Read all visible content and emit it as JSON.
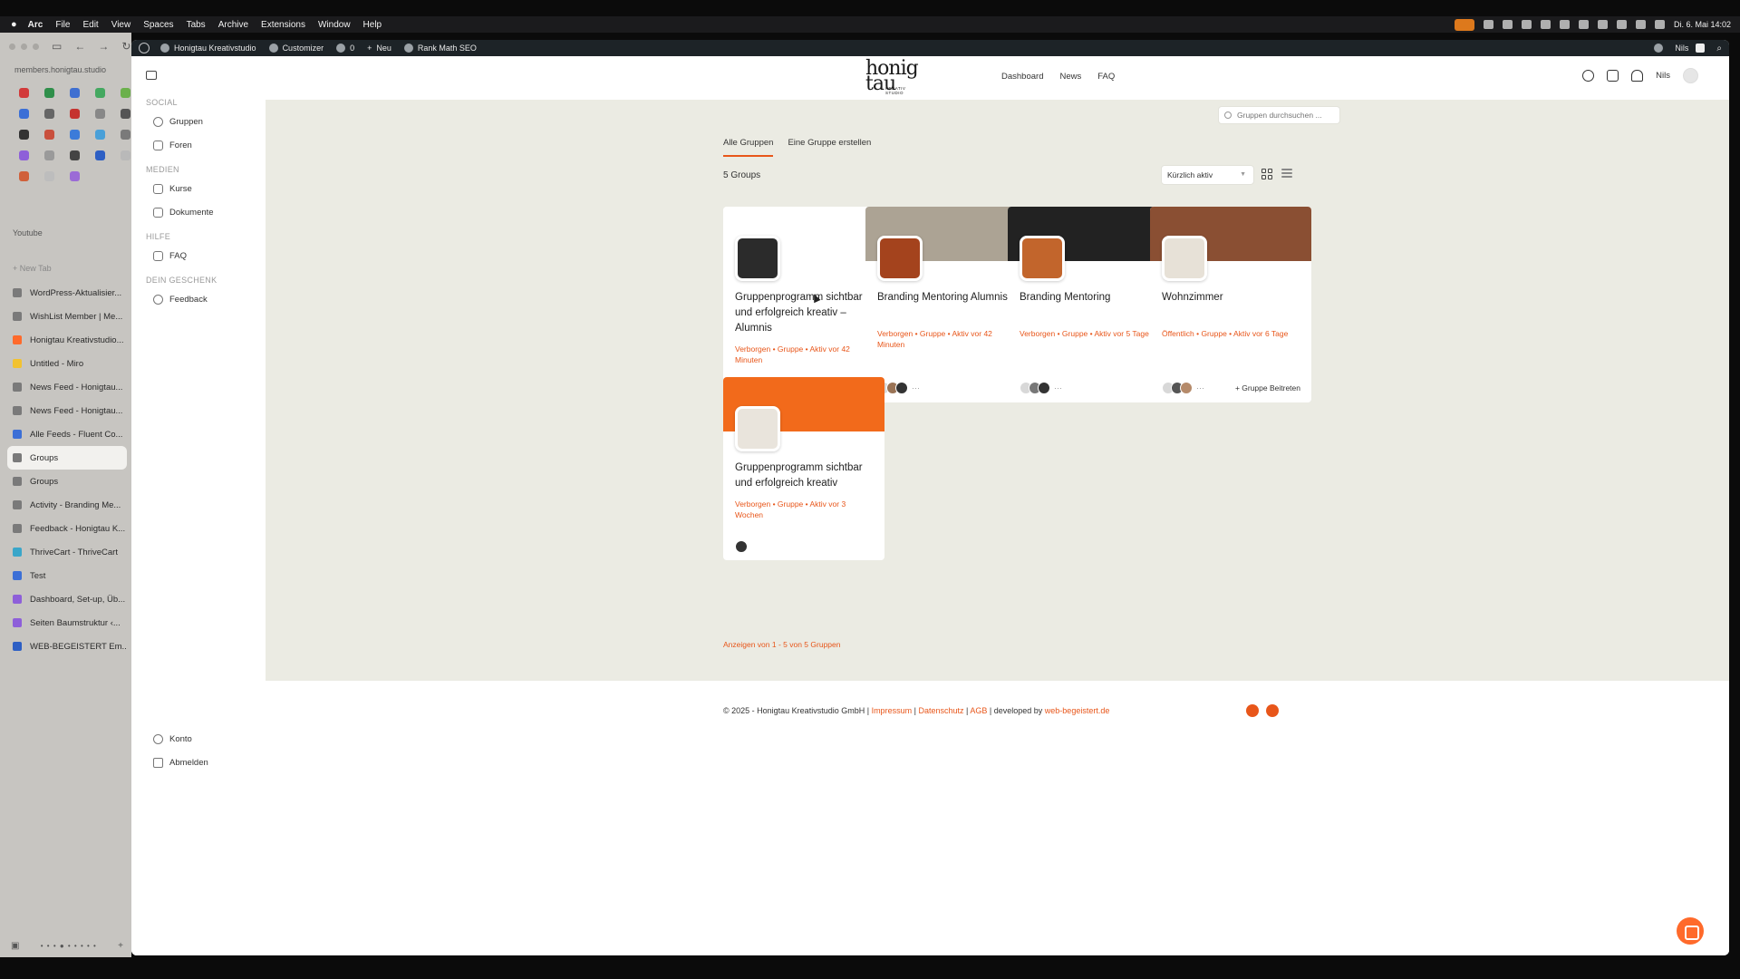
{
  "menubar": {
    "app": "Arc",
    "items": [
      "File",
      "Edit",
      "View",
      "Spaces",
      "Tabs",
      "Archive",
      "Extensions",
      "Window",
      "Help"
    ],
    "clock": "Di. 6. Mai 14:02"
  },
  "arc": {
    "url": "members.honigtau.studio",
    "youtube_label": "Youtube",
    "new_tab": "+  New Tab",
    "favicon_colors": [
      "#d23a3a",
      "#2f8f4a",
      "#3f6fd1",
      "#44a860",
      "#6bb04b",
      "#3b6fd6",
      "#666666",
      "#c5332f",
      "#888888",
      "#555555",
      "#333333",
      "#c9503d",
      "#3c7bd9",
      "#4aa0d8",
      "#7a7a7a",
      "#8e5fd9",
      "#9a9a9a",
      "#444444",
      "#2d5fc4",
      "#b9b9b9",
      "#d0603a",
      "#bdbdbd",
      "#9b6bd6"
    ],
    "tabs": [
      {
        "label": "WordPress-Aktualisier...",
        "color": "#7a7a7a"
      },
      {
        "label": "WishList Member | Me...",
        "color": "#7a7a7a"
      },
      {
        "label": "Honigtau Kreativstudio...",
        "color": "#ff6a2b"
      },
      {
        "label": "Untitled - Miro",
        "color": "#f2c230"
      },
      {
        "label": "News Feed - Honigtau...",
        "color": "#7a7a7a"
      },
      {
        "label": "News Feed - Honigtau...",
        "color": "#7a7a7a"
      },
      {
        "label": "Alle Feeds - Fluent Co...",
        "color": "#3c6fd6"
      },
      {
        "label": "Groups",
        "color": "#7a7a7a"
      },
      {
        "label": "Groups",
        "color": "#7a7a7a"
      },
      {
        "label": "Activity - Branding Me...",
        "color": "#7a7a7a"
      },
      {
        "label": "Feedback - Honigtau K...",
        "color": "#7a7a7a"
      },
      {
        "label": "ThriveCart - ThriveCart",
        "color": "#3aa6c9"
      },
      {
        "label": "Test",
        "color": "#3c6fd6"
      },
      {
        "label": "Dashboard, Set-up, Üb...",
        "color": "#8e5fd9"
      },
      {
        "label": "Seiten Baumstruktur ‹...",
        "color": "#8e5fd9"
      },
      {
        "label": "WEB-BEGEISTERT Em...",
        "color": "#2d5fc4"
      }
    ]
  },
  "wpbar": {
    "site": "Honigtau Kreativstudio",
    "customizer": "Customizer",
    "comments": "0",
    "new": "Neu",
    "seo": "Rank Math SEO",
    "user": "Nils"
  },
  "leftnav": {
    "sections": [
      {
        "title": "SOCIAL",
        "items": [
          "Gruppen",
          "Foren"
        ]
      },
      {
        "title": "MEDIEN",
        "items": [
          "Kurse",
          "Dokumente"
        ]
      },
      {
        "title": "HILFE",
        "items": [
          "FAQ"
        ]
      },
      {
        "title": "DEIN GESCHENK",
        "items": [
          "Feedback"
        ]
      }
    ],
    "konto": "Konto",
    "abmelden": "Abmelden"
  },
  "header": {
    "logo_top": "honig",
    "logo_bottom": "tau",
    "logo_sub": "KREATIV STUDIO",
    "nav": [
      "Dashboard",
      "News",
      "FAQ"
    ],
    "user": "Nils"
  },
  "main": {
    "search_placeholder": "Gruppen durchsuchen ...",
    "tabs": [
      "Alle Gruppen",
      "Eine Gruppe erstellen"
    ],
    "count": "5 Groups",
    "sort": "Kürzlich aktiv",
    "groups": [
      {
        "title": "Gruppenprogramm sichtbar und erfolgreich kreativ – Alumnis",
        "meta": "Verborgen • Gruppe • Aktiv vor 42 Minuten",
        "cover": "#ffffff",
        "thumb": "#2b2b2b",
        "members": [
          "#d8d8d8",
          "#333333"
        ],
        "more": "",
        "join": ""
      },
      {
        "title": "Branding Mentoring Alumnis",
        "meta": "Verborgen • Gruppe • Aktiv vor 42 Minuten",
        "cover": "#aca394",
        "thumb": "#a4431d",
        "members": [
          "#d8d8d8",
          "#9a7355",
          "#333333"
        ],
        "more": "···",
        "join": ""
      },
      {
        "title": "Branding Mentoring",
        "meta": "Verborgen • Gruppe • Aktiv vor 5 Tage",
        "cover": "#222222",
        "thumb": "#c2652c",
        "members": [
          "#d8d8d8",
          "#777777",
          "#333333"
        ],
        "more": "···",
        "join": ""
      },
      {
        "title": "Wohnzimmer",
        "meta": "Öffentlich • Gruppe • Aktiv vor 6 Tage",
        "cover": "#8a4f33",
        "thumb": "#e7e1d7",
        "members": [
          "#d8d8d8",
          "#555555",
          "#b58a6a"
        ],
        "more": "···",
        "join": "+  Gruppe Beitreten"
      },
      {
        "title": "Gruppenprogramm sichtbar und erfolgreich kreativ",
        "meta": "Verborgen • Gruppe • Aktiv vor 3 Wochen",
        "cover": "#f26a1b",
        "thumb": "#e9e4dc",
        "members": [
          "#333333"
        ],
        "more": "",
        "join": ""
      }
    ],
    "pager": "Anzeigen von 1 - 5 von 5 Gruppen"
  },
  "footer": {
    "copyright": "© 2025 - Honigtau Kreativstudio GmbH |",
    "impressum": "Impressum",
    "sep1": "|",
    "datenschutz": "Datenschutz",
    "sep2": "|",
    "agb": "AGB",
    "developed": "| developed by",
    "dev_link": "web-begeistert.de"
  }
}
